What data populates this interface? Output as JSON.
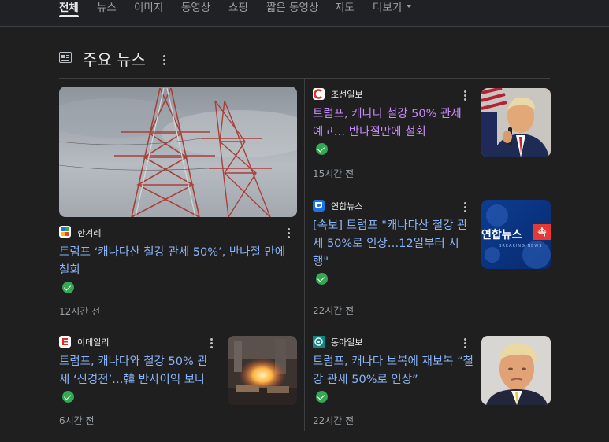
{
  "tabs": [
    {
      "label": "전체",
      "active": true
    },
    {
      "label": "뉴스",
      "active": false
    },
    {
      "label": "이미지",
      "active": false
    },
    {
      "label": "동영상",
      "active": false
    },
    {
      "label": "쇼핑",
      "active": false
    },
    {
      "label": "짧은 동영상",
      "active": false
    },
    {
      "label": "지도",
      "active": false
    },
    {
      "label": "더보기",
      "active": false
    }
  ],
  "section": {
    "title": "주요 뉴스",
    "icon": "newspaper-icon"
  },
  "colors": {
    "link": "#8ab4f8",
    "visited": "#c58af9",
    "verified": "#34a853"
  },
  "articles": [
    {
      "source": "한겨레",
      "source_icon": "hankyoreh-logo",
      "headline": "트럼프 ‘캐나다산 철강 관세 50%’, 반나절 만에 철회",
      "time": "12시간 전",
      "image": "transmission-towers",
      "verified": true
    },
    {
      "source": "조선일보",
      "source_icon": "chosun-logo",
      "headline": "트럼프, 캐나다 철강 50% 관세 예고… 반나절만에 철회",
      "time": "15시간 전",
      "image": "trump-speaking-photo",
      "verified": true,
      "visited": true
    },
    {
      "source": "연합뉴스",
      "source_icon": "yonhap-logo",
      "headline": "[속보] 트럼프 \"캐나다산 철강 관세 50%로 인상…12일부터 시행\"",
      "time": "22시간 전",
      "image": "yonhap-breaking-news-banner",
      "verified": true,
      "image_text": "연합뉴스",
      "image_badge": "속",
      "image_sub": "BREAKING NEWS"
    },
    {
      "source": "이데일리",
      "source_icon": "edaily-logo",
      "headline": "트럼프, 캐나다와 철강 50% 관세 ‘신경전’…韓 반사이익 보나",
      "time": "6시간 전",
      "image": "steel-furnace-photo",
      "verified": true
    },
    {
      "source": "동아일보",
      "source_icon": "donga-logo",
      "headline": "트럼프, 캐나다 보복에 재보복 “철강 관세 50%로 인상”",
      "time": "22시간 전",
      "image": "trump-portrait-photo",
      "verified": true
    }
  ]
}
